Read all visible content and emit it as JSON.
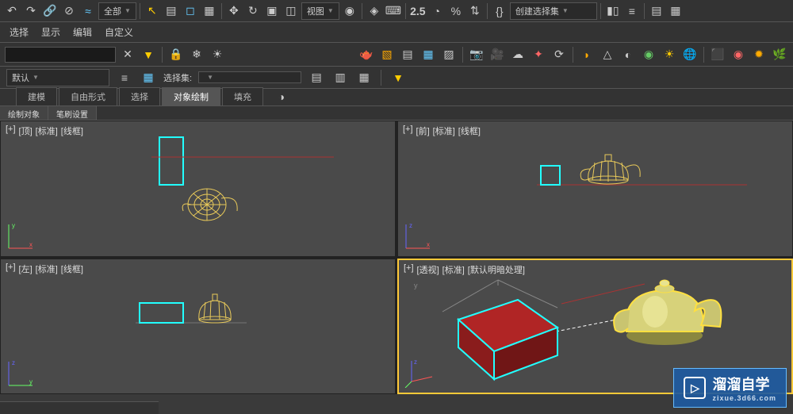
{
  "toolbar": {
    "filter_dd": "全部",
    "view_dd": "视图",
    "spinner": "2.5",
    "create_dd": "创建选择集"
  },
  "menu": {
    "select": "选择",
    "display": "显示",
    "edit": "编辑",
    "custom": "自定义"
  },
  "row3": {
    "default_layer": "默认",
    "selset_label": "选择集:"
  },
  "tabs": {
    "modeling": "建模",
    "freeform": "自由形式",
    "select": "选择",
    "objpaint": "对象绘制",
    "fill": "填充"
  },
  "subtabs": {
    "paintobj": "绘制对象",
    "brush": "笔刷设置"
  },
  "vp": {
    "plus": "[+]",
    "top": "[顶]",
    "front": "[前]",
    "left": "[左]",
    "persp": "[透视]",
    "standard": "[标准]",
    "wire": "[线框]",
    "shaded": "[默认明暗处理]"
  },
  "watermark": {
    "title": "溜溜自学",
    "url": "zixue.3d66.com"
  }
}
